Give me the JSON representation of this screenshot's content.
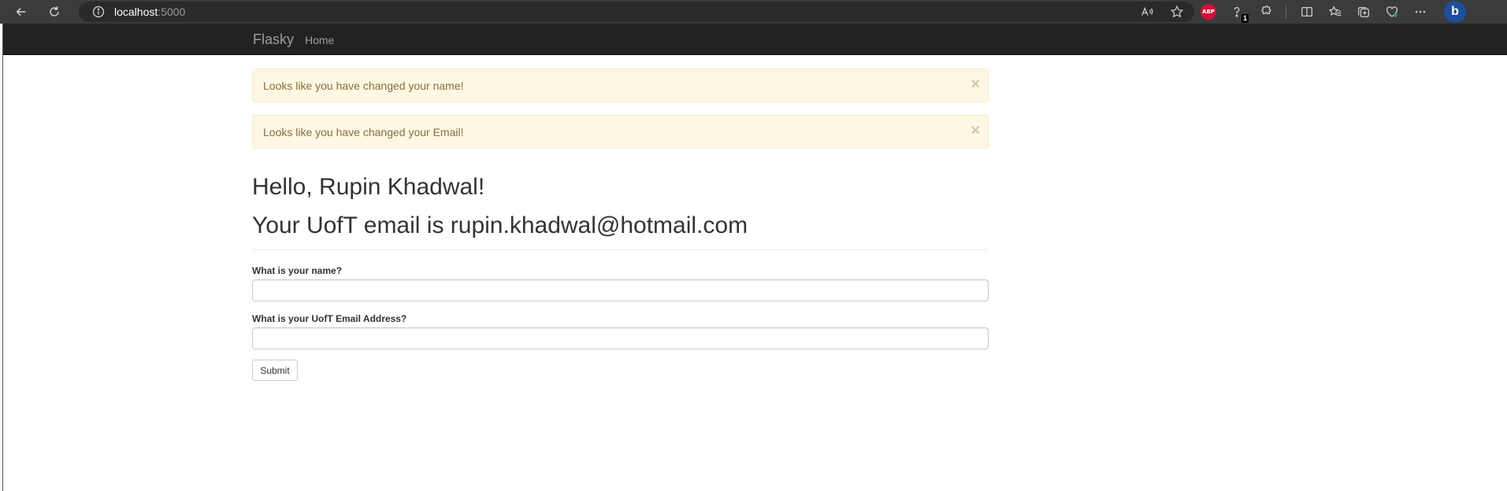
{
  "browser": {
    "url_host": "localhost",
    "url_port": ":5000",
    "extension_badge": "1",
    "abp_label": "ABP",
    "bing_label": "b"
  },
  "navbar": {
    "brand": "Flasky",
    "home_link": "Home"
  },
  "alerts": [
    {
      "message": "Looks like you have changed your name!",
      "close": "×"
    },
    {
      "message": "Looks like you have changed your Email!",
      "close": "×"
    }
  ],
  "header": {
    "greeting": "Hello, Rupin Khadwal!",
    "email_line": "Your UofT email is rupin.khadwal@hotmail.com"
  },
  "form": {
    "name_label": "What is your name?",
    "name_value": "",
    "email_label": "What is your UofT Email Address?",
    "email_value": "",
    "submit_label": "Submit"
  },
  "colors": {
    "navbar_bg": "#222222",
    "alert_bg": "#fcf8e3",
    "alert_text": "#8a6d3b"
  }
}
